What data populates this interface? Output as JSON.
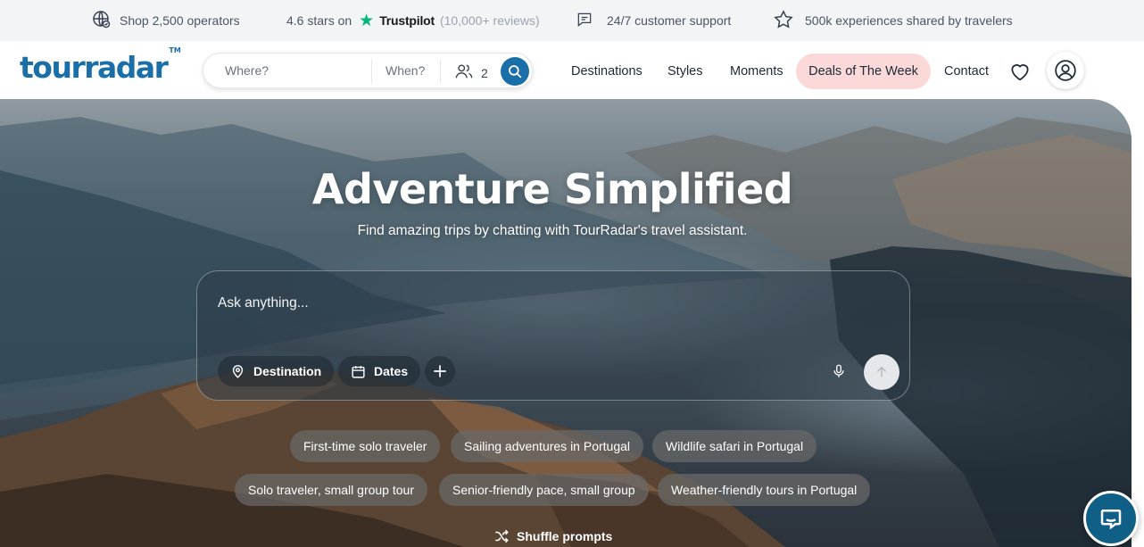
{
  "topbar": {
    "operators": "Shop 2,500 operators",
    "rating_prefix": "4.6 stars on",
    "trustpilot": "Trustpilot",
    "reviews": "(10,000+ reviews)",
    "support": "24/7 customer support",
    "experiences": "500k experiences shared by travelers"
  },
  "header": {
    "logo": "tourradar",
    "logo_tm": "TM",
    "search": {
      "where_placeholder": "Where?",
      "when_placeholder": "When?",
      "travelers": "2"
    },
    "nav": {
      "destinations": "Destinations",
      "styles": "Styles",
      "moments": "Moments",
      "deals": "Deals of The Week",
      "contact": "Contact"
    }
  },
  "hero": {
    "title": "Adventure Simplified",
    "subtitle": "Find amazing trips by chatting with TourRadar's travel assistant.",
    "chat": {
      "placeholder": "Ask anything...",
      "destination": "Destination",
      "dates": "Dates"
    },
    "suggestions": [
      "First-time solo traveler",
      "Sailing adventures in Portugal",
      "Wildlife safari in Portugal",
      "Solo traveler, small group tour",
      "Senior-friendly pace, small group",
      "Weather-friendly tours in Portugal"
    ],
    "shuffle": "Shuffle prompts"
  },
  "colors": {
    "brand_blue": "#1b6fa8",
    "trustpilot_green": "#00b67a",
    "deals_pink": "#fbd9d9"
  }
}
